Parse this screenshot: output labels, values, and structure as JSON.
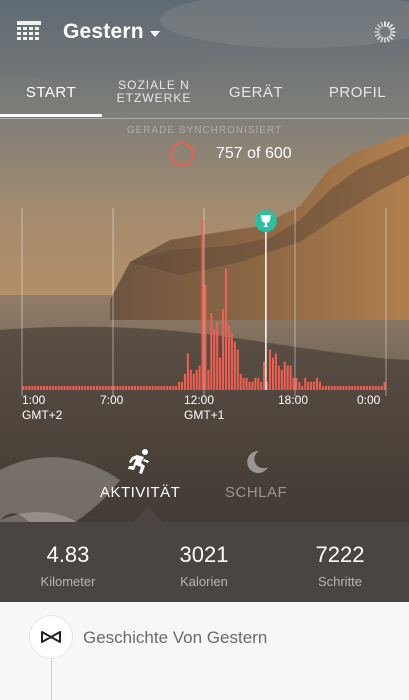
{
  "header": {
    "title": "Gestern",
    "menu_icon": "grid-icon",
    "sync_icon": "sync-spinner-icon"
  },
  "tabs": [
    {
      "label": "START",
      "active": true
    },
    {
      "label": "SOZIALE N\nETZWERKE",
      "active": false
    },
    {
      "label": "GERÄT",
      "active": false
    },
    {
      "label": "PROFIL",
      "active": false
    }
  ],
  "sync_status": "GERADE SYNCHRONISIERT",
  "goal": {
    "value": "757",
    "suffix": "of 600",
    "ring_color": "#ee5f51"
  },
  "chart_data": {
    "type": "bar",
    "color": "#ee5f51",
    "x_ticks": [
      {
        "label": "1:00",
        "sub": "GMT+2"
      },
      {
        "label": "7:00",
        "sub": ""
      },
      {
        "label": "12:00",
        "sub": "GMT+1"
      },
      {
        "label": "18:00",
        "sub": ""
      },
      {
        "label": "0:00",
        "sub": ""
      }
    ],
    "goal_marker": {
      "icon": "trophy-icon",
      "color": "#2bbfa4",
      "position_fraction": 0.67
    },
    "values": [
      1,
      1,
      1,
      1,
      1,
      1,
      1,
      1,
      1,
      1,
      1,
      1,
      1,
      1,
      1,
      1,
      1,
      1,
      1,
      1,
      1,
      1,
      1,
      1,
      1,
      1,
      1,
      1,
      1,
      1,
      1,
      1,
      1,
      1,
      1,
      1,
      1,
      1,
      1,
      1,
      1,
      1,
      1,
      1,
      1,
      1,
      1,
      1,
      1,
      1,
      1,
      1,
      1,
      2,
      2,
      4,
      9,
      5,
      4,
      5,
      6,
      42,
      26,
      5,
      19,
      15,
      17,
      8,
      20,
      30,
      16,
      14,
      12,
      10,
      4,
      3,
      3,
      2,
      2,
      3,
      3,
      2,
      7,
      2,
      10,
      8,
      9,
      6,
      5,
      7,
      6,
      6,
      3,
      3,
      2,
      1,
      3,
      2,
      2,
      2,
      3,
      2,
      1,
      1,
      1,
      1,
      1,
      1,
      1,
      1,
      1,
      1,
      1,
      1,
      1,
      1,
      1,
      1,
      1,
      1,
      1,
      1,
      1,
      2
    ]
  },
  "modes": {
    "activity": {
      "label": "AKTIVITÄT",
      "icon": "running-person-icon",
      "active": true
    },
    "sleep": {
      "label": "SCHLAF",
      "icon": "moon-icon",
      "active": false
    }
  },
  "stats": [
    {
      "value": "4.83",
      "label": "Kilometer"
    },
    {
      "value": "3021",
      "label": "Kalorien"
    },
    {
      "value": "7222",
      "label": "Schritte"
    }
  ],
  "story": {
    "title": "Geschichte Von Gestern",
    "icon": "misfit-logo-icon"
  }
}
